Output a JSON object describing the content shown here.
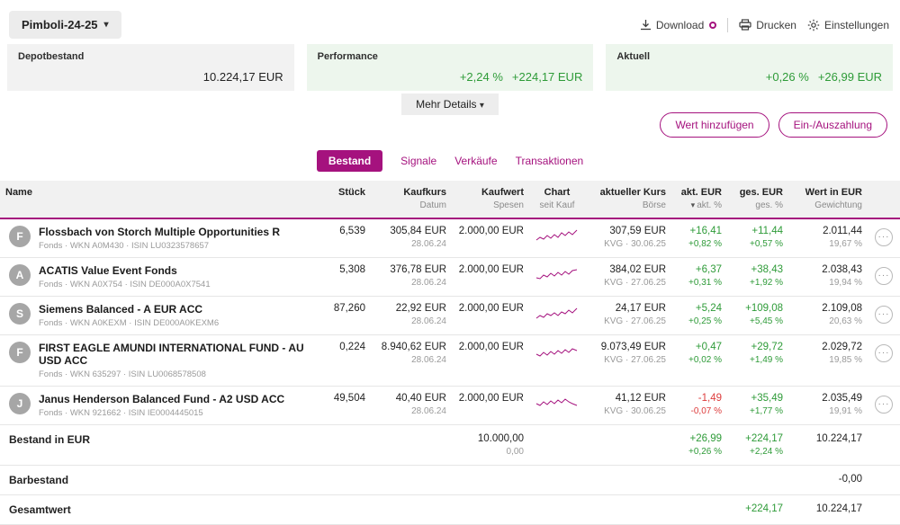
{
  "colors": {
    "accent": "#a5127e",
    "positive": "#2e9b38",
    "negative": "#dd3c3c"
  },
  "topbar": {
    "portfolio": "Pimboli-24-25",
    "download": "Download",
    "drucken": "Drucken",
    "einstellungen": "Einstellungen"
  },
  "summary": {
    "depot_label": "Depotbestand",
    "depot_value": "10.224,17 EUR",
    "perf_label": "Performance",
    "perf_pct": "+2,24 %",
    "perf_value": "+224,17 EUR",
    "akt_label": "Aktuell",
    "akt_pct": "+0,26 %",
    "akt_value": "+26,99 EUR",
    "more": "Mehr Details"
  },
  "actions": {
    "add": "Wert hinzufügen",
    "cash": "Ein-/Auszahlung"
  },
  "tabs": {
    "bestand": "Bestand",
    "signale": "Signale",
    "verkaeufe": "Verkäufe",
    "transaktionen": "Transaktionen"
  },
  "table": {
    "h": {
      "name": "Name",
      "stueck": "Stück",
      "kaufkurs": "Kaufkurs",
      "datum": "Datum",
      "kaufwert": "Kaufwert",
      "spesen": "Spesen",
      "chart": "Chart",
      "seit_kauf": "seit Kauf",
      "kurs": "aktueller Kurs",
      "boerse": "Börse",
      "akt_eur": "akt. EUR",
      "akt_pct": "akt. %",
      "ges_eur": "ges. EUR",
      "ges_pct": "ges. %",
      "wert": "Wert in EUR",
      "gewichtung": "Gewichtung"
    },
    "rows": [
      {
        "initial": "F",
        "name": "Flossbach von Storch Multiple Opportunities R",
        "meta": "Fonds · WKN A0M430 · ISIN LU0323578657",
        "stueck": "6,539",
        "kaufkurs": "305,84 EUR",
        "datum": "28.06.24",
        "kaufwert": "2.000,00 EUR",
        "kurs": "307,59 EUR",
        "boerse": "KVG · 30.06.25",
        "akt": "+16,41",
        "akt_pct": "+0,82 %",
        "ges": "+11,44",
        "ges_pct": "+0,57 %",
        "wert": "2.011,44",
        "gew": "19,67 %"
      },
      {
        "initial": "A",
        "name": "ACATIS Value Event Fonds",
        "meta": "Fonds · WKN A0X754 · ISIN DE000A0X7541",
        "stueck": "5,308",
        "kaufkurs": "376,78 EUR",
        "datum": "28.06.24",
        "kaufwert": "2.000,00 EUR",
        "kurs": "384,02 EUR",
        "boerse": "KVG · 27.06.25",
        "akt": "+6,37",
        "akt_pct": "+0,31 %",
        "ges": "+38,43",
        "ges_pct": "+1,92 %",
        "wert": "2.038,43",
        "gew": "19,94 %"
      },
      {
        "initial": "S",
        "name": "Siemens Balanced - A EUR ACC",
        "meta": "Fonds · WKN A0KEXM · ISIN DE000A0KEXM6",
        "stueck": "87,260",
        "kaufkurs": "22,92 EUR",
        "datum": "28.06.24",
        "kaufwert": "2.000,00 EUR",
        "kurs": "24,17 EUR",
        "boerse": "KVG · 27.06.25",
        "akt": "+5,24",
        "akt_pct": "+0,25 %",
        "ges": "+109,08",
        "ges_pct": "+5,45 %",
        "wert": "2.109,08",
        "gew": "20,63 %"
      },
      {
        "initial": "F",
        "name": "FIRST EAGLE AMUNDI INTERNATIONAL FUND - AU USD ACC",
        "meta": "Fonds · WKN 635297 · ISIN LU0068578508",
        "stueck": "0,224",
        "kaufkurs": "8.940,62 EUR",
        "datum": "28.06.24",
        "kaufwert": "2.000,00 EUR",
        "kurs": "9.073,49 EUR",
        "boerse": "KVG · 27.06.25",
        "akt": "+0,47",
        "akt_pct": "+0,02 %",
        "ges": "+29,72",
        "ges_pct": "+1,49 %",
        "wert": "2.029,72",
        "gew": "19,85 %"
      },
      {
        "initial": "J",
        "name": "Janus Henderson Balanced Fund - A2 USD ACC",
        "meta": "Fonds · WKN 921662 · ISIN IE0004445015",
        "stueck": "49,504",
        "kaufkurs": "40,40 EUR",
        "datum": "28.06.24",
        "kaufwert": "2.000,00 EUR",
        "kurs": "41,12 EUR",
        "boerse": "KVG · 30.06.25",
        "akt": "-1,49",
        "akt_pct": "-0,07 %",
        "ges": "+35,49",
        "ges_pct": "+1,77 %",
        "wert": "2.035,49",
        "gew": "19,91 %"
      }
    ],
    "totals": {
      "bestand": {
        "label": "Bestand in EUR",
        "kaufwert": "10.000,00",
        "spesen": "0,00",
        "akt": "+26,99",
        "akt_pct": "+0,26 %",
        "ges": "+224,17",
        "ges_pct": "+2,24 %",
        "wert": "10.224,17"
      },
      "bar": {
        "label": "Barbestand",
        "wert": "-0,00"
      },
      "gesamt": {
        "label": "Gesamtwert",
        "ges": "+224,17",
        "wert": "10.224,17"
      }
    }
  }
}
